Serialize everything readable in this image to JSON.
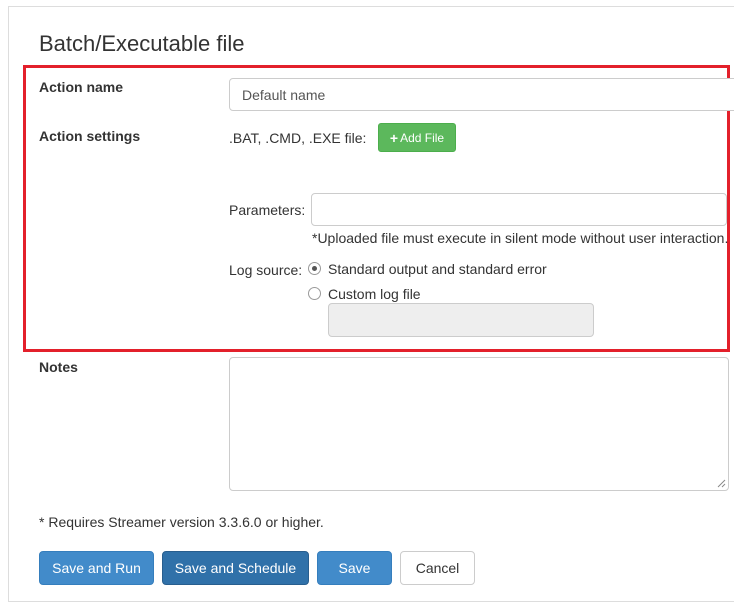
{
  "form": {
    "title": "Batch/Executable file",
    "action_name_label": "Action name",
    "action_name_value": "Default name",
    "action_settings_label": "Action settings",
    "file_label": ".BAT, .CMD, .EXE file:",
    "add_file_label": "Add File",
    "parameters_label": "Parameters:",
    "parameters_value": "",
    "silent_note": "*Uploaded file must execute in silent mode without user interaction.",
    "log_source_label": "Log source:",
    "log_options": [
      {
        "label": "Standard output and standard error",
        "checked": true
      },
      {
        "label": "Custom log file",
        "checked": false
      }
    ],
    "custom_log_value": "",
    "notes_label": "Notes",
    "requirement_note": "* Requires Streamer version 3.3.6.0 or higher."
  },
  "buttons": {
    "save_and_run": "Save and Run",
    "save_and_schedule": "Save and Schedule",
    "save": "Save",
    "cancel": "Cancel"
  },
  "colors": {
    "highlight_border": "#e3202b",
    "add_button": "#5cb85c",
    "primary_button": "#428bca",
    "schedule_button": "#3071a9"
  }
}
